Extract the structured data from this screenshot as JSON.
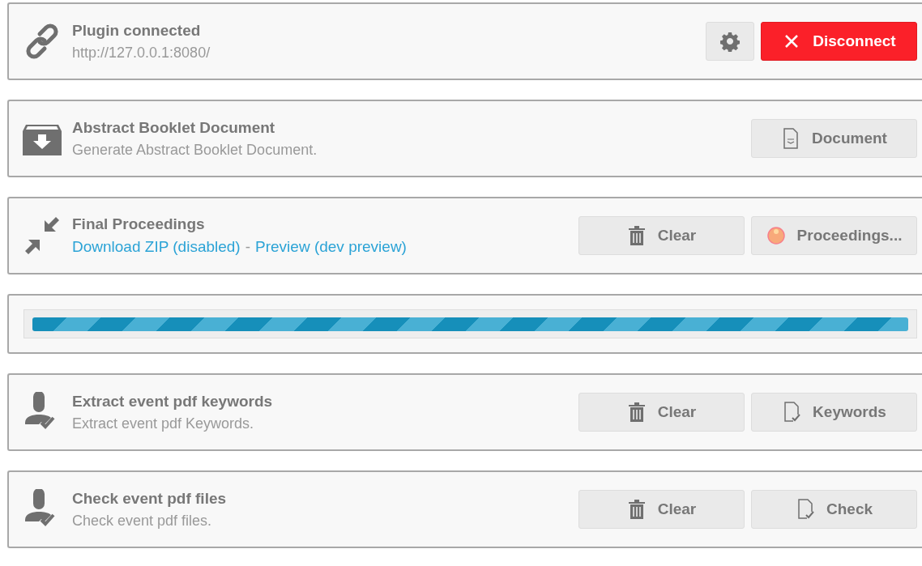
{
  "panels": [
    {
      "kind": "connection",
      "title": "Plugin connected",
      "subtitle": "http://127.0.0.1:8080/",
      "buttons": [
        {
          "kind": "settings"
        },
        {
          "kind": "disconnect",
          "label": "Disconnect"
        }
      ]
    },
    {
      "kind": "booklet",
      "title": "Abstract Booklet Document",
      "subtitle": "Generate Abstract Booklet Document.",
      "buttons": [
        {
          "kind": "document",
          "label": "Document"
        }
      ]
    },
    {
      "kind": "proceedings",
      "title": "Final Proceedings",
      "links": [
        {
          "text": "Download ZIP (disabled)"
        },
        {
          "text": "Preview (dev preview)"
        }
      ],
      "separator": "-",
      "buttons": [
        {
          "kind": "clear",
          "label": "Clear"
        },
        {
          "kind": "proceedings",
          "label": "Proceedings..."
        }
      ]
    },
    {
      "kind": "progress"
    },
    {
      "kind": "check",
      "title": "Extract event pdf keywords",
      "subtitle": "Extract event pdf Keywords.",
      "buttons": [
        {
          "kind": "clear",
          "label": "Clear"
        },
        {
          "kind": "check",
          "label": "Keywords"
        }
      ]
    },
    {
      "kind": "check",
      "title": "Check event pdf files",
      "subtitle": "Check event pdf files.",
      "buttons": [
        {
          "kind": "clear",
          "label": "Clear"
        },
        {
          "kind": "check",
          "label": "Check"
        }
      ]
    }
  ]
}
